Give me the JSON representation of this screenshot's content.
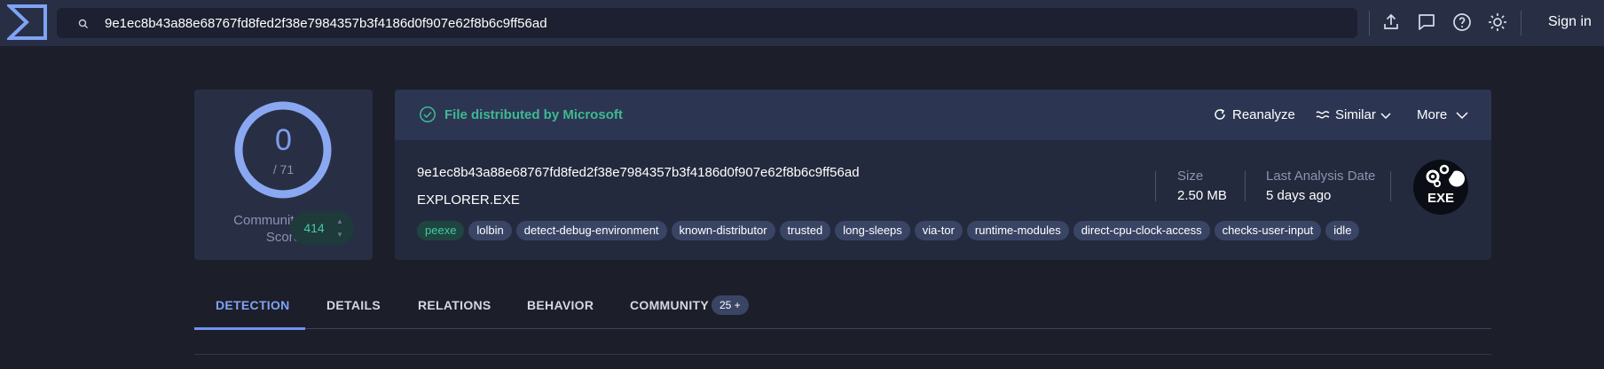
{
  "topbar": {
    "search_value": "9e1ec8b43a88e68767fd8fed2f38e7984357b3f4186d0f907e62f8b6c9ff56ad",
    "signin_label": "Sign in"
  },
  "score": {
    "detections": "0",
    "total": "/ 71",
    "community_label_1": "Community",
    "community_label_2": "Score",
    "community_value": "414"
  },
  "file": {
    "trust_label": "File distributed by Microsoft",
    "hash": "9e1ec8b43a88e68767fd8fed2f38e7984357b3f4186d0f907e62f8b6c9ff56ad",
    "name": "EXPLORER.EXE",
    "size_label": "Size",
    "size_value": "2.50 MB",
    "date_label": "Last Analysis Date",
    "date_value": "5 days ago",
    "type_badge": "EXE",
    "tags": [
      "peexe",
      "lolbin",
      "detect-debug-environment",
      "known-distributor",
      "trusted",
      "long-sleeps",
      "via-tor",
      "runtime-modules",
      "direct-cpu-clock-access",
      "checks-user-input",
      "idle"
    ]
  },
  "actions": {
    "reanalyze": "Reanalyze",
    "similar": "Similar",
    "more": "More"
  },
  "tabs": {
    "detection": "DETECTION",
    "details": "DETAILS",
    "relations": "RELATIONS",
    "behavior": "BEHAVIOR",
    "community": "COMMUNITY",
    "community_badge": "25 +"
  },
  "colors": {
    "accent": "#7fa3f5",
    "trusted": "#3fb893",
    "background": "#1c1e29"
  }
}
